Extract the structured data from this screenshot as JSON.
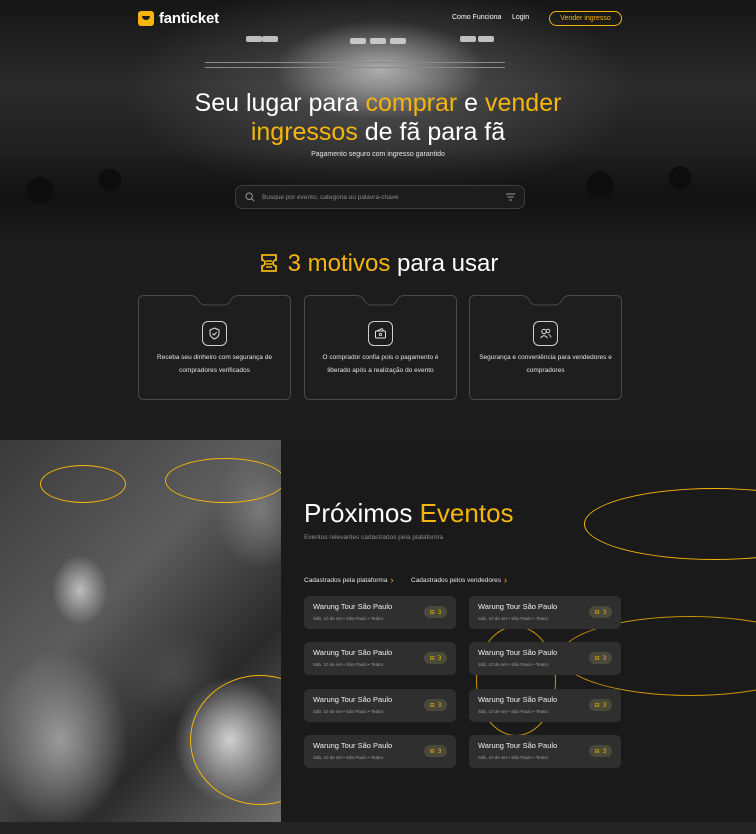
{
  "brand": {
    "name": "fanticket",
    "accent": "#f5b50a"
  },
  "nav": {
    "links": [
      "Como Funciona",
      "Login"
    ],
    "cta": "Vender ingresso"
  },
  "hero": {
    "title_line1_a": "Seu lugar para ",
    "title_line1_b": "comprar",
    "title_line1_c": " e ",
    "title_line1_d": "vender",
    "title_line2_a": "ingressos",
    "title_line2_b": " de fã para fã",
    "subtitle": "Pagamento seguro com ingresso garantido",
    "search_placeholder": "Busque por evento, categoria ou palavra-chave"
  },
  "motivos": {
    "title_number": "3 motivos",
    "title_rest": " para usar",
    "cards": [
      {
        "icon": "shield-check-icon",
        "text": "Receba seu dinheiro com segurança de compradores verificados"
      },
      {
        "icon": "wallet-icon",
        "text": "O comprador confia pois o pagamento é liberado após a realização do evento"
      },
      {
        "icon": "users-icon",
        "text": "Segurança e conveniência para vendedores e compradores"
      }
    ]
  },
  "events": {
    "title_a": "Próximos ",
    "title_b": "Eventos",
    "subtitle": "Eventos relevantes cadastrados pela plataforma",
    "tabs": [
      "Cadastrados pela plataforma",
      "Cadastrados pelos vendedores"
    ],
    "columns": [
      [
        {
          "name": "Warung Tour São Paulo",
          "meta": "Sáb, 10 de set  •  São Paulo  •  Teatro",
          "badge": "3"
        },
        {
          "name": "Warung Tour São Paulo",
          "meta": "Sáb, 10 de set  •  São Paulo  •  Teatro",
          "badge": "3"
        },
        {
          "name": "Warung Tour São Paulo",
          "meta": "Sáb, 10 de set  •  São Paulo  •  Teatro",
          "badge": "3"
        },
        {
          "name": "Warung Tour São Paulo",
          "meta": "Sáb, 10 de set  •  São Paulo  •  Teatro",
          "badge": "3"
        }
      ],
      [
        {
          "name": "Warung Tour São Paulo",
          "meta": "Sáb, 10 de set  •  São Paulo  •  Teatro",
          "badge": "3"
        },
        {
          "name": "Warung Tour São Paulo",
          "meta": "Sáb, 10 de set  •  São Paulo  •  Teatro",
          "badge": "3"
        },
        {
          "name": "Warung Tour São Paulo",
          "meta": "Sáb, 10 de set  •  São Paulo  •  Teatro",
          "badge": "3"
        },
        {
          "name": "Warung Tour São Paulo",
          "meta": "Sáb, 10 de set  •  São Paulo  •  Teatro",
          "badge": "3"
        }
      ]
    ]
  }
}
